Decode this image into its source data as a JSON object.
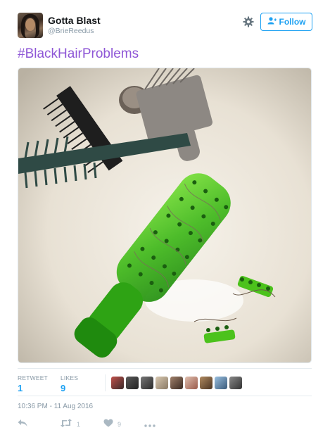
{
  "user": {
    "name": "Gotta Blast",
    "handle": "@BrieReedus"
  },
  "follow_label": "Follow",
  "tweet_text": "#BlackHairProblems",
  "stats": {
    "retweet_label": "RETWEET",
    "retweet_count": "1",
    "likes_label": "LIKES",
    "likes_count": "9"
  },
  "timestamp": "10:36 PM - 11 Aug 2016",
  "actions": {
    "retweet_count": "1",
    "like_count": "9"
  },
  "colors": {
    "hashtag": "#8e56d6",
    "accent": "#1da1f2",
    "muted": "#8899a6",
    "brush": "#4cc21c"
  },
  "icons": [
    "gear-icon",
    "follow-person-icon",
    "reply-icon",
    "retweet-icon",
    "like-icon",
    "more-icon"
  ]
}
